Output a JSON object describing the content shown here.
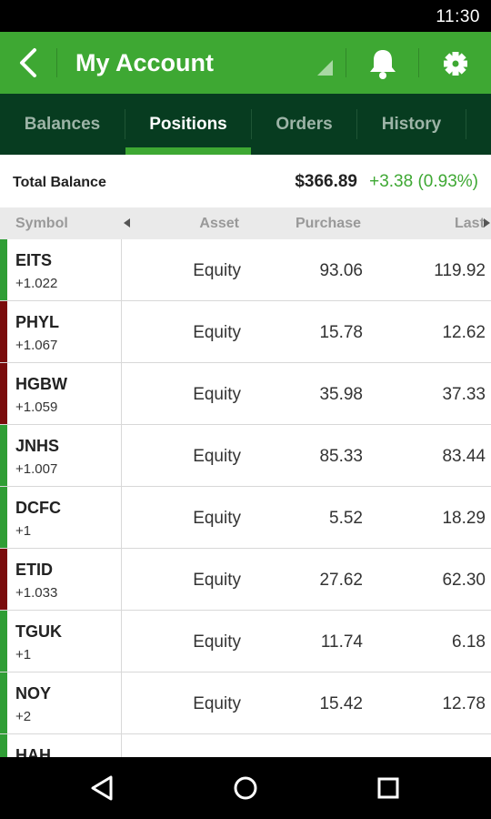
{
  "status_bar": {
    "time": "11:30"
  },
  "app_bar": {
    "title": "My Account"
  },
  "tabs": [
    {
      "label": "Balances",
      "active": false
    },
    {
      "label": "Positions",
      "active": true
    },
    {
      "label": "Orders",
      "active": false
    },
    {
      "label": "History",
      "active": false
    }
  ],
  "summary": {
    "label": "Total Balance",
    "amount": "$366.89",
    "change": "+3.38 (0.93%)"
  },
  "columns": {
    "symbol": "Symbol",
    "asset": "Asset",
    "purchase": "Purchase",
    "last": "Last"
  },
  "colors": {
    "up": "#2f9e35",
    "down": "#7a0c0c",
    "brand": "#3ea833",
    "tab_bg": "#073c20"
  },
  "positions": [
    {
      "symbol": "EITS",
      "qty": "+1.022",
      "asset": "Equity",
      "purchase": "93.06",
      "last": "119.92",
      "direction": "up"
    },
    {
      "symbol": "PHYL",
      "qty": "+1.067",
      "asset": "Equity",
      "purchase": "15.78",
      "last": "12.62",
      "direction": "down"
    },
    {
      "symbol": "HGBW",
      "qty": "+1.059",
      "asset": "Equity",
      "purchase": "35.98",
      "last": "37.33",
      "direction": "down"
    },
    {
      "symbol": "JNHS",
      "qty": "+1.007",
      "asset": "Equity",
      "purchase": "85.33",
      "last": "83.44",
      "direction": "up"
    },
    {
      "symbol": "DCFC",
      "qty": "+1",
      "asset": "Equity",
      "purchase": "5.52",
      "last": "18.29",
      "direction": "up"
    },
    {
      "symbol": "ETID",
      "qty": "+1.033",
      "asset": "Equity",
      "purchase": "27.62",
      "last": "62.30",
      "direction": "down"
    },
    {
      "symbol": "TGUK",
      "qty": "+1",
      "asset": "Equity",
      "purchase": "11.74",
      "last": "6.18",
      "direction": "up"
    },
    {
      "symbol": "NOY",
      "qty": "+2",
      "asset": "Equity",
      "purchase": "15.42",
      "last": "12.78",
      "direction": "up"
    },
    {
      "symbol": "HAH",
      "qty": "",
      "asset": "",
      "purchase": "",
      "last": "",
      "direction": "up"
    }
  ]
}
